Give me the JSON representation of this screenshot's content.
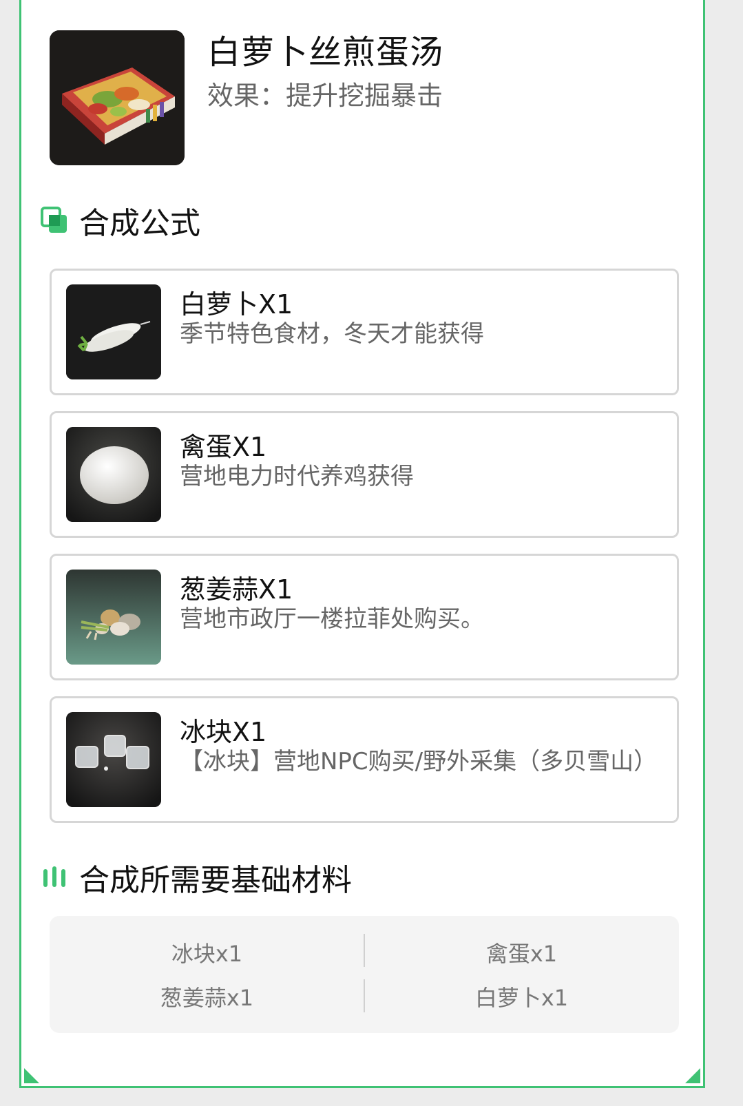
{
  "dish": {
    "title": "白萝卜丝煎蛋汤",
    "effect": "效果：提升挖掘暴击"
  },
  "recipe_section": {
    "title": "合成公式",
    "items": [
      {
        "name": "白萝卜X1",
        "desc": "季节特色食材，冬天才能获得",
        "icon": "radish-icon"
      },
      {
        "name": "禽蛋X1",
        "desc": "营地电力时代养鸡获得",
        "icon": "egg-icon"
      },
      {
        "name": "葱姜蒜X1",
        "desc": "营地市政厅一楼拉菲处购买。",
        "icon": "aromatics-icon"
      },
      {
        "name": "冰块X1",
        "desc": "【冰块】营地NPC购买/野外采集（多贝雪山）",
        "icon": "ice-cube-icon"
      }
    ]
  },
  "materials_section": {
    "title": "合成所需要基础材料",
    "rows": [
      [
        "冰块x1",
        "禽蛋x1"
      ],
      [
        "葱姜蒜x1",
        "白萝卜x1"
      ]
    ]
  },
  "colors": {
    "accent": "#3fc274",
    "border": "#d6d6d6",
    "muted_text": "#666666"
  }
}
